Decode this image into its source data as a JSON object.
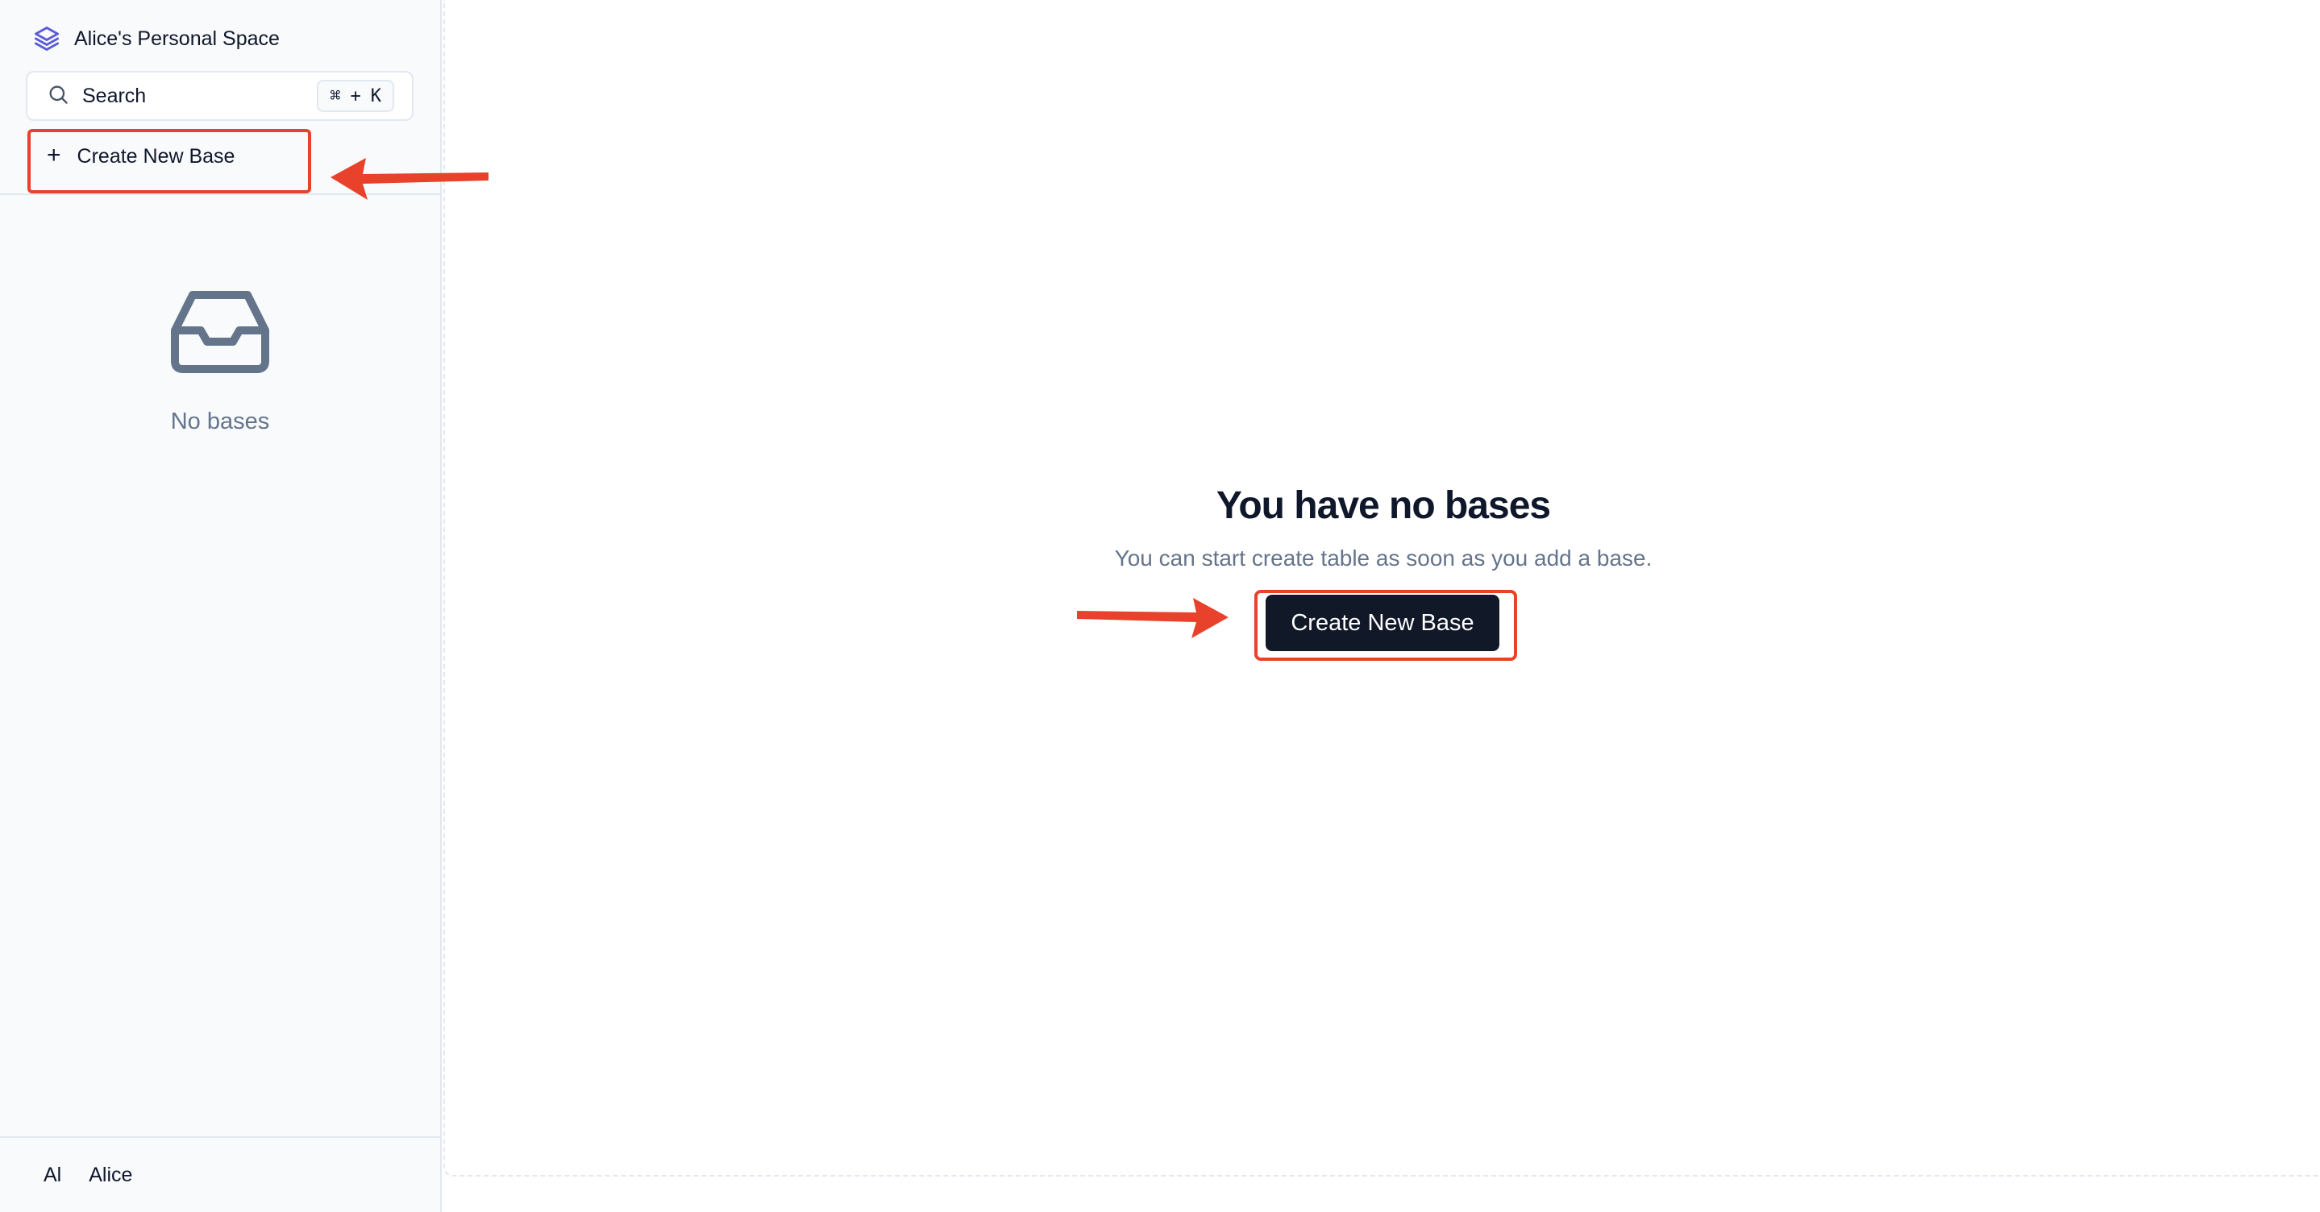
{
  "sidebar": {
    "space_title": "Alice's Personal Space",
    "search": {
      "label": "Search",
      "shortcut_symbol": "⌘",
      "shortcut_plus": "+",
      "shortcut_key": "K"
    },
    "create_base_label": "Create New Base",
    "empty_text": "No bases",
    "user": {
      "initials": "Al",
      "name": "Alice"
    }
  },
  "main": {
    "empty_title": "You have no bases",
    "empty_description": "You can start create table as soon as you add a base.",
    "create_base_button": "Create New Base"
  },
  "colors": {
    "accent": "#5b5bd6",
    "annotation": "#e8412c",
    "primary_button": "#111827"
  }
}
